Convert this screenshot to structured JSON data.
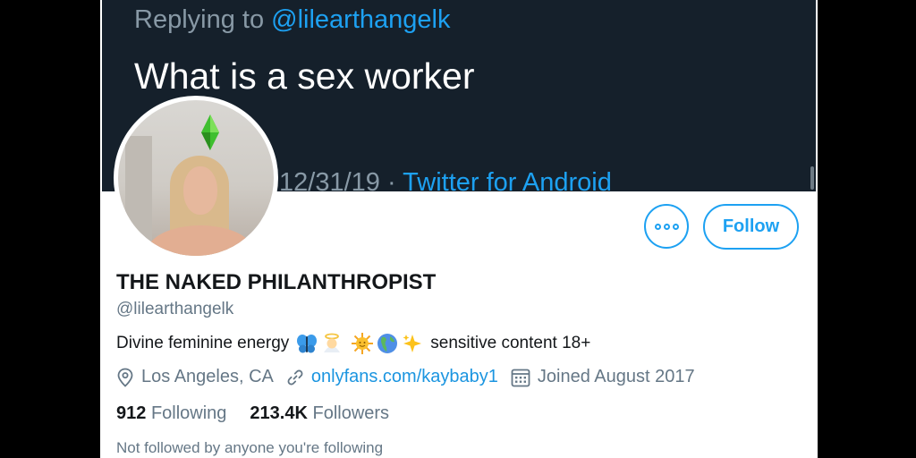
{
  "tweet": {
    "replying_prefix": "Replying to ",
    "replying_handle": "@lilearthangelk",
    "text": "What is a sex worker",
    "date_fragment": "12/31/19 · ",
    "source": "Twitter for Android"
  },
  "profile": {
    "display_name": "THE NAKED PHILANTHROPIST",
    "screen_name": "@lilearthangelk",
    "bio_start": "Divine feminine energy",
    "bio_emojis": [
      "butterfly",
      "angel",
      "sun-with-face",
      "globe-americas",
      "sparkles"
    ],
    "bio_end": "sensitive content 18+",
    "location": "Los Angeles, CA",
    "website": "onlyfans.com/kaybaby1",
    "joined": "Joined August 2017",
    "following_count": "912",
    "following_label": "Following",
    "followers_count": "213.4K",
    "followers_label": "Followers",
    "not_followed_note": "Not followed by anyone you're following"
  },
  "buttons": {
    "follow_label": "Follow"
  },
  "colors": {
    "accent": "#1da1f2",
    "banner_bg": "#15202b",
    "text_primary": "#14171a",
    "text_secondary": "#657786"
  }
}
